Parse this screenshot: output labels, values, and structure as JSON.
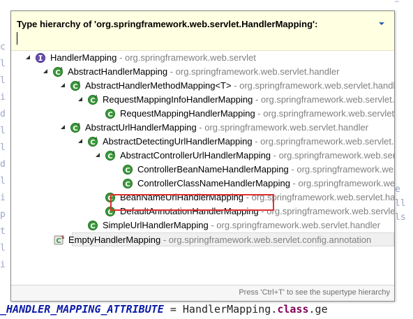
{
  "popup": {
    "title": "Type hierarchy of 'org.springframework.web.servlet.HandlerMapping':",
    "filter_value": "",
    "footer_hint": "Press 'Ctrl+T' to see the supertype hierarchy"
  },
  "tree": [
    {
      "name": "HandlerMapping",
      "pkg": " - org.springframework.web.servlet",
      "icon": "interface-icon",
      "twisty": "expanded",
      "selected": false
    },
    {
      "name": "AbstractHandlerMapping",
      "pkg": " - org.springframework.web.servlet.handler",
      "icon": "abstract-class-icon",
      "twisty": "expanded",
      "selected": false
    },
    {
      "name": "AbstractHandlerMethodMapping<T>",
      "pkg": " - org.springframework.web.servlet.handler",
      "icon": "abstract-class-icon",
      "twisty": "expanded",
      "selected": false
    },
    {
      "name": "RequestMappingInfoHandlerMapping",
      "pkg": " - org.springframework.web.servlet.method",
      "icon": "abstract-class-icon",
      "twisty": "expanded",
      "selected": false
    },
    {
      "name": "RequestMappingHandlerMapping",
      "pkg": " - org.springframework.web.servlet.mvc.method",
      "icon": "class-icon",
      "twisty": "none",
      "selected": false
    },
    {
      "name": "AbstractUrlHandlerMapping",
      "pkg": " - org.springframework.web.servlet.handler",
      "icon": "abstract-class-icon",
      "twisty": "expanded",
      "selected": false
    },
    {
      "name": "AbstractDetectingUrlHandlerMapping",
      "pkg": " - org.springframework.web.servlet.handler",
      "icon": "abstract-class-icon",
      "twisty": "expanded",
      "selected": false
    },
    {
      "name": "AbstractControllerUrlHandlerMapping",
      "pkg": " - org.springframework.web.servlet.mvc.support",
      "icon": "abstract-class-icon",
      "twisty": "expanded",
      "selected": false
    },
    {
      "name": "ControllerBeanNameHandlerMapping",
      "pkg": " - org.springframework.web.servlet.mvc.support",
      "icon": "class-icon",
      "twisty": "none",
      "selected": false
    },
    {
      "name": "ControllerClassNameHandlerMapping",
      "pkg": " - org.springframework.web.servlet.mvc.support",
      "icon": "class-icon",
      "twisty": "none",
      "selected": false
    },
    {
      "name": "BeanNameUrlHandlerMapping",
      "pkg": " - org.springframework.web.servlet.handler",
      "icon": "class-icon",
      "twisty": "none",
      "selected": false
    },
    {
      "name": "DefaultAnnotationHandlerMapping",
      "pkg": " - org.springframework.web.servlet.mvc.annotation",
      "icon": "class-icon",
      "twisty": "none",
      "selected": false
    },
    {
      "name": "SimpleUrlHandlerMapping",
      "pkg": " - org.springframework.web.servlet.handler",
      "icon": "class-icon",
      "twisty": "none",
      "selected": false
    },
    {
      "name": "EmptyHandlerMapping",
      "pkg": " - org.springframework.web.servlet.config.annotation",
      "icon": "static-final-class-icon",
      "twisty": "none",
      "selected": true
    }
  ],
  "editor": {
    "bottom_line_constant": "_HANDLER_MAPPING_ATTRIBUTE",
    "bottom_line_eq": " = HandlerMapping.",
    "bottom_line_kw": "class",
    "bottom_line_tail": ".ge",
    "gutter": [
      "c",
      "l",
      "l",
      "i",
      "d",
      "l",
      "l",
      "d",
      "l",
      "i",
      "p",
      "t",
      "l",
      "i"
    ],
    "right": [
      "e",
      "ll",
      "ls"
    ]
  },
  "colors": {
    "header_bg": "#ffffe1",
    "highlight_border": "#e03030",
    "class_icon_green": "#3c9a3c",
    "interface_icon_purple": "#6a4fb0"
  }
}
